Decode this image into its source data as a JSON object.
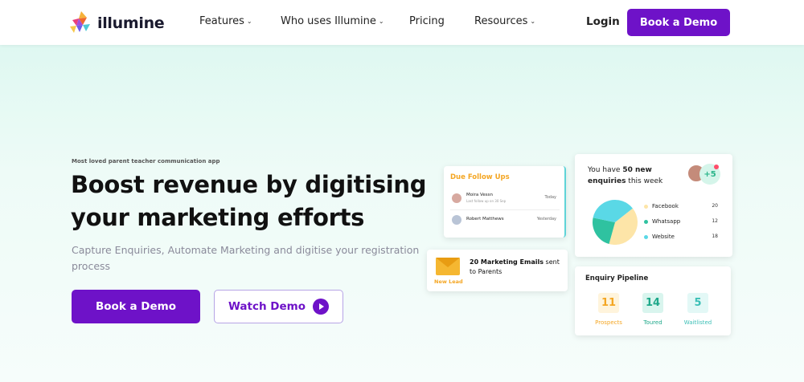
{
  "header": {
    "brand": "illumine",
    "nav": [
      {
        "label": "Features",
        "dropdown": true
      },
      {
        "label": "Who uses Illumine",
        "dropdown": true
      },
      {
        "label": "Pricing",
        "dropdown": false
      },
      {
        "label": "Resources",
        "dropdown": true
      }
    ],
    "chevron": "⌄",
    "login": "Login",
    "cta": "Book a Demo"
  },
  "hero": {
    "eyebrow": "Most loved parent teacher communication app",
    "title": "Boost revenue by digitising your marketing efforts",
    "subtitle": "Capture Enquiries, Automate Marketing and digitise your registration process",
    "primary_cta": "Book a Demo",
    "secondary_cta": "Watch Demo"
  },
  "follow_ups": {
    "title": "Due Follow Ups",
    "rows": [
      {
        "name": "Moira Vessn",
        "note": "Last follow up on 30 Sep",
        "when": "Today"
      },
      {
        "name": "Robert Matthews",
        "note": "",
        "when": "Yesterday"
      }
    ]
  },
  "email_card": {
    "badge": "New Lead",
    "text_bold": "20 Marketing Emails",
    "text_rest": " sent to Parents"
  },
  "enquiries": {
    "prefix": "You have ",
    "count": "50 new enquiries",
    "suffix": " this week",
    "extra": "+5",
    "sources": [
      {
        "name": "Facebook",
        "value": 20,
        "color": "#fde5a8"
      },
      {
        "name": "Whatsapp",
        "value": 12,
        "color": "#2fc2a0"
      },
      {
        "name": "Website",
        "value": 18,
        "color": "#5ad8e6"
      }
    ]
  },
  "pipeline": {
    "title": "Enquiry Pipeline",
    "stages": [
      {
        "label": "Prospects",
        "value": "11",
        "color": "#f4a623",
        "bg": "#fff4dc"
      },
      {
        "label": "Toured",
        "value": "14",
        "color": "#1ea88a",
        "bg": "#d9f5ee"
      },
      {
        "label": "Waitlisted",
        "value": "5",
        "color": "#3bbfb6",
        "bg": "#e3f8f6"
      }
    ]
  },
  "colors": {
    "brand_purple": "#6e12c8",
    "accent_orange": "#f4a623"
  }
}
